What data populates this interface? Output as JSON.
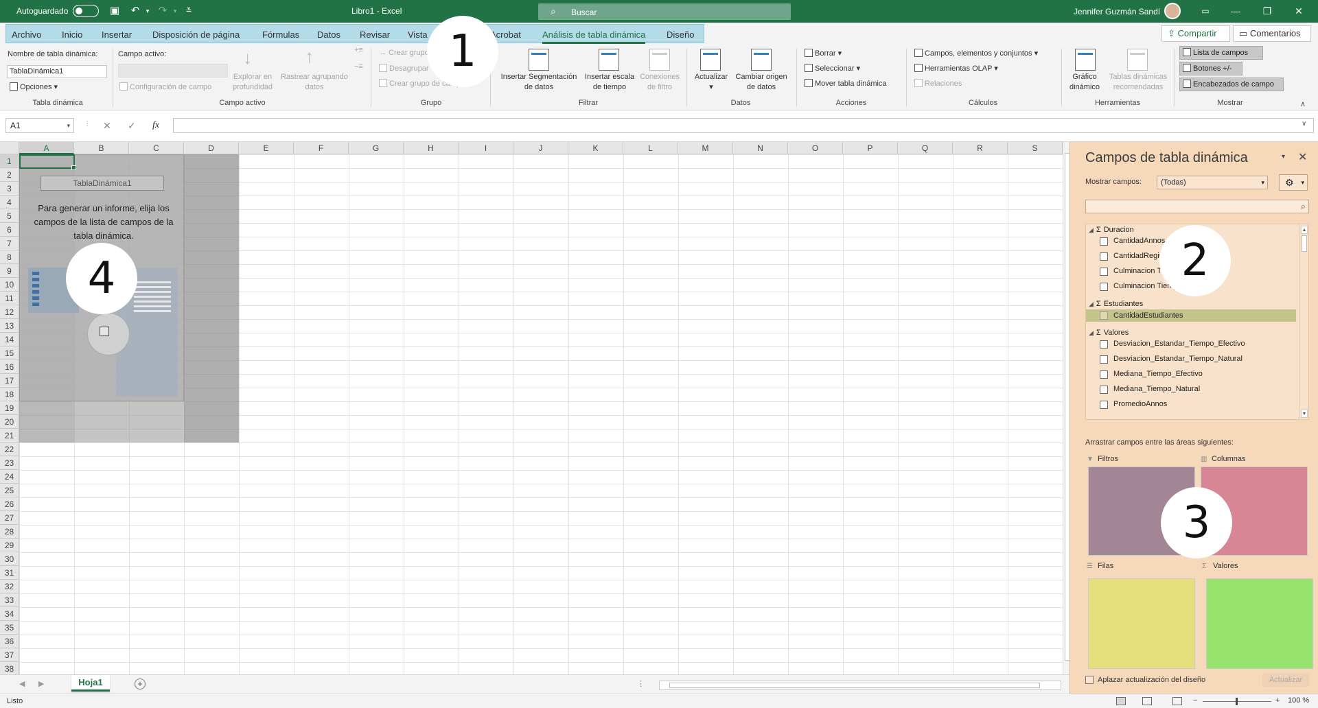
{
  "titlebar": {
    "autosave_label": "Autoguardado",
    "doc_title": "Libro1  -  Excel",
    "search_placeholder": "Buscar",
    "user_name": "Jennifer Guzmán Sandí"
  },
  "tabs": [
    {
      "label": "Archivo"
    },
    {
      "label": "Inicio"
    },
    {
      "label": "Insertar"
    },
    {
      "label": "Disposición de página"
    },
    {
      "label": "Fórmulas"
    },
    {
      "label": "Datos"
    },
    {
      "label": "Revisar"
    },
    {
      "label": "Vista"
    },
    {
      "label": "Acrobat"
    },
    {
      "label": "Análisis de tabla dinámica"
    },
    {
      "label": "Diseño"
    }
  ],
  "header_buttons": {
    "share": "Compartir",
    "comments": "Comentarios"
  },
  "ribbon": {
    "pivot_table": {
      "name_label": "Nombre de tabla dinámica:",
      "name_value": "TablaDinámica1",
      "options": "Opciones",
      "group_label": "Tabla dinámica"
    },
    "active_field": {
      "label": "Campo activo:",
      "field_settings": "Configuración de campo",
      "drill_down": "Explorar en\nprofundidad",
      "drill_up": "Rastrear agrupando\ndatos",
      "group_label": "Campo activo"
    },
    "group": {
      "group_selection": "Crear grupo",
      "ungroup": "Desagrupar",
      "group_field": "Crear grupo de campo",
      "group_label": "Grupo"
    },
    "filter": {
      "insert_slicer": "Insertar Segmentación\nde datos",
      "insert_timeline": "Insertar escala\nde tiempo",
      "filter_connections": "Conexiones\nde filtro",
      "group_label": "Filtrar"
    },
    "data": {
      "refresh": "Actualizar",
      "change_source": "Cambiar origen\nde datos",
      "group_label": "Datos"
    },
    "actions": {
      "clear": "Borrar",
      "select": "Seleccionar",
      "move": "Mover tabla dinámica",
      "group_label": "Acciones"
    },
    "calculations": {
      "fields_items": "Campos, elementos y conjuntos",
      "olap": "Herramientas OLAP",
      "relationships": "Relaciones",
      "group_label": "Cálculos"
    },
    "tools": {
      "pivot_chart": "Gráfico\ndinámico",
      "recommended": "Tablas dinámicas\nrecomendadas",
      "group_label": "Herramientas"
    },
    "show": {
      "field_list": "Lista de campos",
      "buttons": "Botones +/-",
      "field_headers": "Encabezados de campo",
      "group_label": "Mostrar"
    }
  },
  "formula_bar": {
    "name_box": "A1",
    "fx": "fx"
  },
  "grid": {
    "columns": [
      "A",
      "B",
      "C",
      "D",
      "E",
      "F",
      "G",
      "H",
      "I",
      "J",
      "K",
      "L",
      "M",
      "N",
      "O",
      "P",
      "Q",
      "R",
      "S"
    ],
    "rows": [
      "1",
      "2",
      "3",
      "4",
      "5",
      "6",
      "7",
      "8",
      "9",
      "10",
      "11",
      "12",
      "13",
      "14",
      "15",
      "16",
      "17",
      "18",
      "19",
      "20",
      "21",
      "22",
      "23",
      "24",
      "25",
      "26",
      "27",
      "28",
      "29",
      "30",
      "31",
      "32",
      "33",
      "34",
      "35",
      "36",
      "37",
      "38"
    ]
  },
  "pivot_placeholder": {
    "name": "TablaDinámica1",
    "message": "Para generar un informe, elija los campos de la lista de campos de la tabla dinámica."
  },
  "callouts": {
    "c1": "1",
    "c2": "2",
    "c3": "3",
    "c4": "4"
  },
  "sheets": {
    "active": "Hoja1"
  },
  "status": {
    "ready": "Listo",
    "zoom": "100 %"
  },
  "pane": {
    "title": "Campos de tabla dinámica",
    "show_fields_label": "Mostrar campos:",
    "show_fields_value": "(Todas)",
    "groups": [
      {
        "name": "Duracion",
        "fields": [
          "CantidadAnnos",
          "CantidadRegistro",
          "Culminacion Tiem",
          "Culminacion Tiempo"
        ]
      },
      {
        "name": "Estudiantes",
        "fields": [
          "CantidadEstudiantes"
        ]
      },
      {
        "name": "Valores",
        "fields": [
          "Desviacion_Estandar_Tiempo_Efectivo",
          "Desviacion_Estandar_Tiempo_Natural",
          "Mediana_Tiempo_Efectivo",
          "Mediana_Tiempo_Natural",
          "PromedioAnnos"
        ]
      }
    ],
    "drag_label": "Arrastrar campos entre las áreas siguientes:",
    "areas": {
      "filters": "Filtros",
      "columns": "Columnas",
      "rows": "Filas",
      "values": "Valores"
    },
    "area_colors": {
      "filters": "#a38696",
      "columns": "#d88596",
      "rows": "#e6df7d",
      "values": "#98e36e"
    },
    "defer_label": "Aplazar actualización del diseño",
    "update_button": "Actualizar"
  }
}
